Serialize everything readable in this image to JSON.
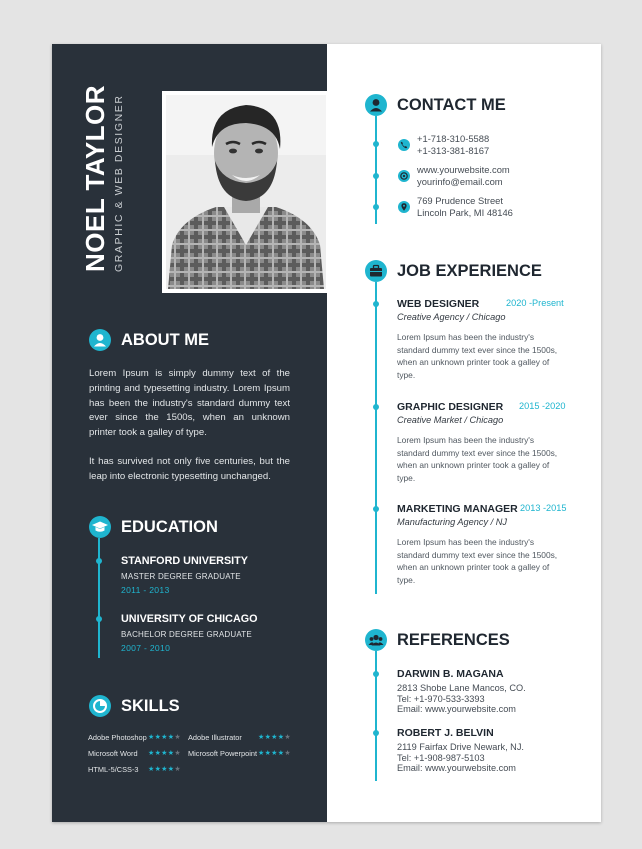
{
  "person": {
    "name": "NOEL TAYLOR",
    "title": "GRAPHIC & WEB DESIGNER"
  },
  "about": {
    "heading": "ABOUT ME",
    "paragraph1": "Lorem Ipsum is simply dummy text of the printing and typesetting industry. Lorem Ipsum has been the industry's standard dummy text ever since the 1500s, when an unknown printer took a galley of type.",
    "paragraph2": "It has survived not only five centuries, but the leap into electronic typesetting unchanged."
  },
  "education": {
    "heading": "EDUCATION",
    "items": [
      {
        "school": "STANFORD UNIVERSITY",
        "degree": "MASTER DEGREE GRADUATE",
        "years": "2011 - 2013"
      },
      {
        "school": "UNIVERSITY OF CHICAGO",
        "degree": "BACHELOR DEGREE GRADUATE",
        "years": "2007 - 2010"
      }
    ]
  },
  "skills": {
    "heading": "SKILLS",
    "items": [
      {
        "name": "Adobe Photoshop",
        "rating": 4,
        "max": 5
      },
      {
        "name": "Adobe Illustrator",
        "rating": 4,
        "max": 5
      },
      {
        "name": "Microsoft Word",
        "rating": 4,
        "max": 5
      },
      {
        "name": "Microsoft Powerpoint",
        "rating": 4,
        "max": 5
      },
      {
        "name": "HTML-5/CSS-3",
        "rating": 4,
        "max": 5
      }
    ]
  },
  "contact": {
    "heading": "CONTACT ME",
    "phone1": "+1-718-310-5588",
    "phone2": "+1-313-381-8167",
    "website": "www.yourwebsite.com",
    "email": "yourinfo@email.com",
    "address1": "769 Prudence Street",
    "address2": "Lincoln Park, MI 48146"
  },
  "experience": {
    "heading": "JOB EXPERIENCE",
    "jobs": [
      {
        "title": "WEB DESIGNER",
        "dates": "2020 -Present",
        "company": "Creative Agency / Chicago",
        "desc": "Lorem Ipsum has been the industry's standard dummy text ever since the 1500s, when an unknown printer took a galley of type."
      },
      {
        "title": "GRAPHIC DESIGNER",
        "dates": "2015 -2020",
        "company": "Creative Market / Chicago",
        "desc": "Lorem Ipsum has been the industry's standard dummy text ever since the 1500s, when an unknown printer took a galley of type."
      },
      {
        "title": "MARKETING MANAGER",
        "dates": "2013 -2015",
        "company": "Manufacturing Agency / NJ",
        "desc": "Lorem Ipsum has been the industry's standard dummy text ever since the 1500s, when an unknown printer took a galley of type."
      }
    ]
  },
  "references": {
    "heading": "REFERENCES",
    "items": [
      {
        "name": "DARWIN B. MAGANA",
        "address": "2813 Shobe Lane Mancos, CO.",
        "tel": "Tel: +1-970-533-3393",
        "email": "Email: www.yourwebsite.com"
      },
      {
        "name": "ROBERT J. BELVIN",
        "address": "2119 Fairfax Drive Newark, NJ.",
        "tel": "Tel: +1-908-987-5103",
        "email": "Email: www.yourwebsite.com"
      }
    ]
  },
  "colors": {
    "accent": "#1fb5cf",
    "sidebar": "#29313a",
    "page": "#ffffff"
  }
}
